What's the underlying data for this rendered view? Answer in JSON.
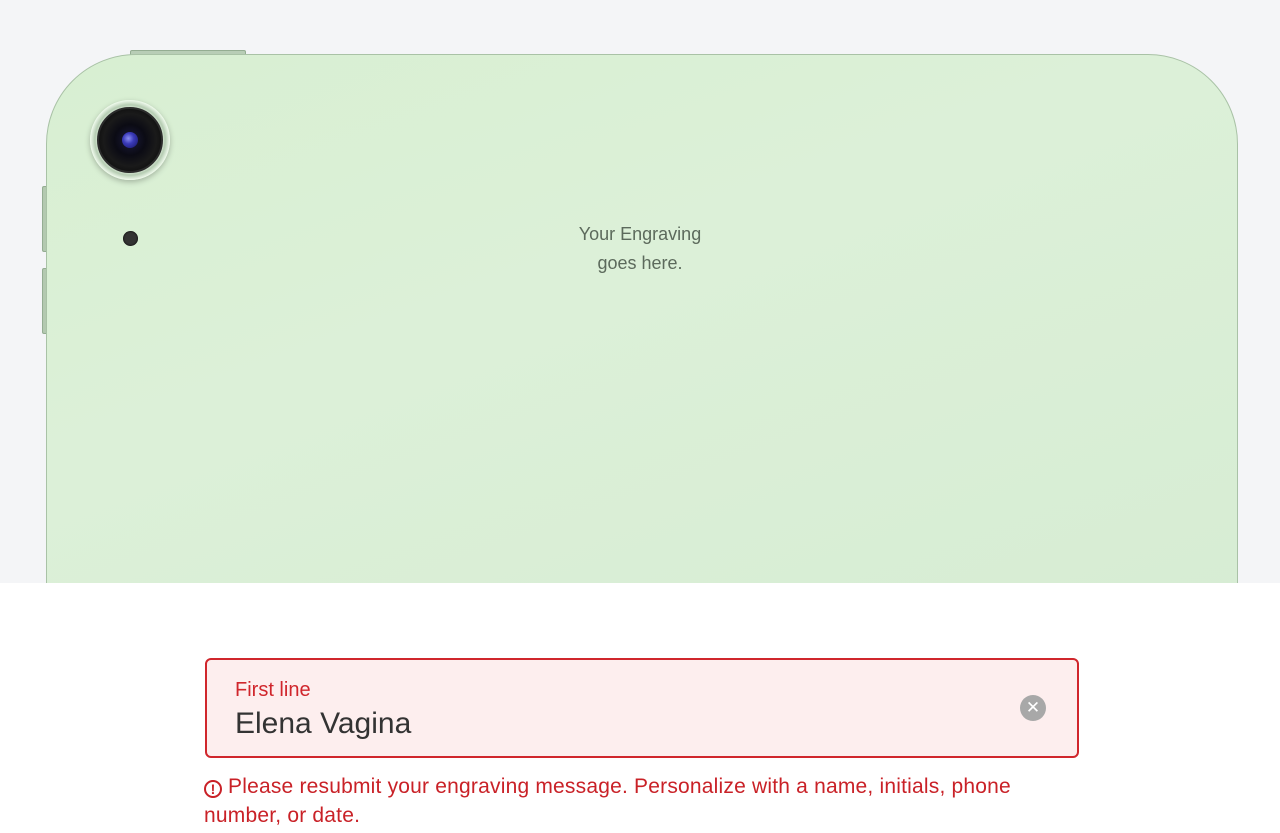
{
  "preview": {
    "engraving_line1": "Your Engraving",
    "engraving_line2": "goes here.",
    "device_color": "#d9efd4"
  },
  "field": {
    "label": "First line",
    "value": "Elena Vagina",
    "clear_icon": "close-circle-icon"
  },
  "error": {
    "icon": "alert-circle-icon",
    "icon_glyph": "!",
    "message": "Please resubmit your engraving message. Personalize with a name, initials, phone number, or date."
  },
  "colors": {
    "error": "#d0262c",
    "error_background": "#fdeeee"
  }
}
